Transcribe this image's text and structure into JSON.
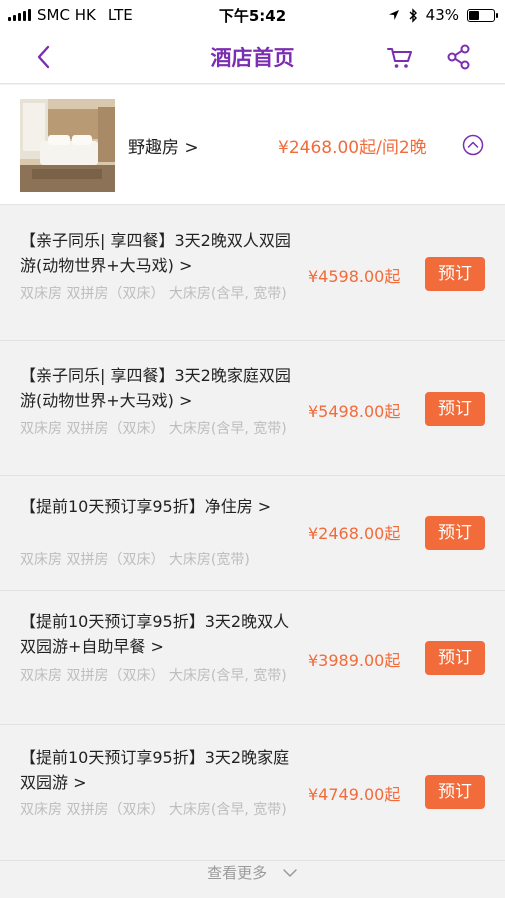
{
  "status_bar": {
    "carrier": "SMC HK",
    "network": "LTE",
    "time": "下午5:42",
    "battery": "43%",
    "battery_level": 0.43
  },
  "nav": {
    "title": "酒店首页"
  },
  "room": {
    "name": "野趣房 >",
    "price": "¥2468.00起/间2晚"
  },
  "packages": [
    {
      "title": "【亲子同乐| 享四餐】3天2晚双人双园游(动物世界+大马戏) >",
      "rooms": "双床房 双拼房（双床） 大床房(含早, 宽带)",
      "price": "¥4598.00起",
      "button": "预订"
    },
    {
      "title": "【亲子同乐| 享四餐】3天2晚家庭双园游(动物世界+大马戏) >",
      "rooms": "双床房 双拼房（双床） 大床房(含早, 宽带)",
      "price": "¥5498.00起",
      "button": "预订"
    },
    {
      "title": "【提前10天预订享95折】净住房 >",
      "rooms": "双床房 双拼房（双床） 大床房(宽带)",
      "price": "¥2468.00起",
      "button": "预订"
    },
    {
      "title": "【提前10天预订享95折】3天2晚双人双园游+自助早餐 >",
      "rooms": "双床房 双拼房（双床） 大床房(含早, 宽带)",
      "price": "¥3989.00起",
      "button": "预订"
    },
    {
      "title": "【提前10天预订享95折】3天2晚家庭双园游 >",
      "rooms": "双床房 双拼房（双床） 大床房(含早, 宽带)",
      "price": "¥4749.00起",
      "button": "预订"
    }
  ],
  "more": {
    "label": "查看更多"
  },
  "colors": {
    "brand_purple": "#7b2fb0",
    "price_orange": "#f26b3a"
  },
  "icons": {
    "back": "chevron-left-icon",
    "cart": "cart-icon",
    "share": "share-icon",
    "collapse": "chevron-up-circle-icon",
    "more": "chevron-down-icon"
  }
}
